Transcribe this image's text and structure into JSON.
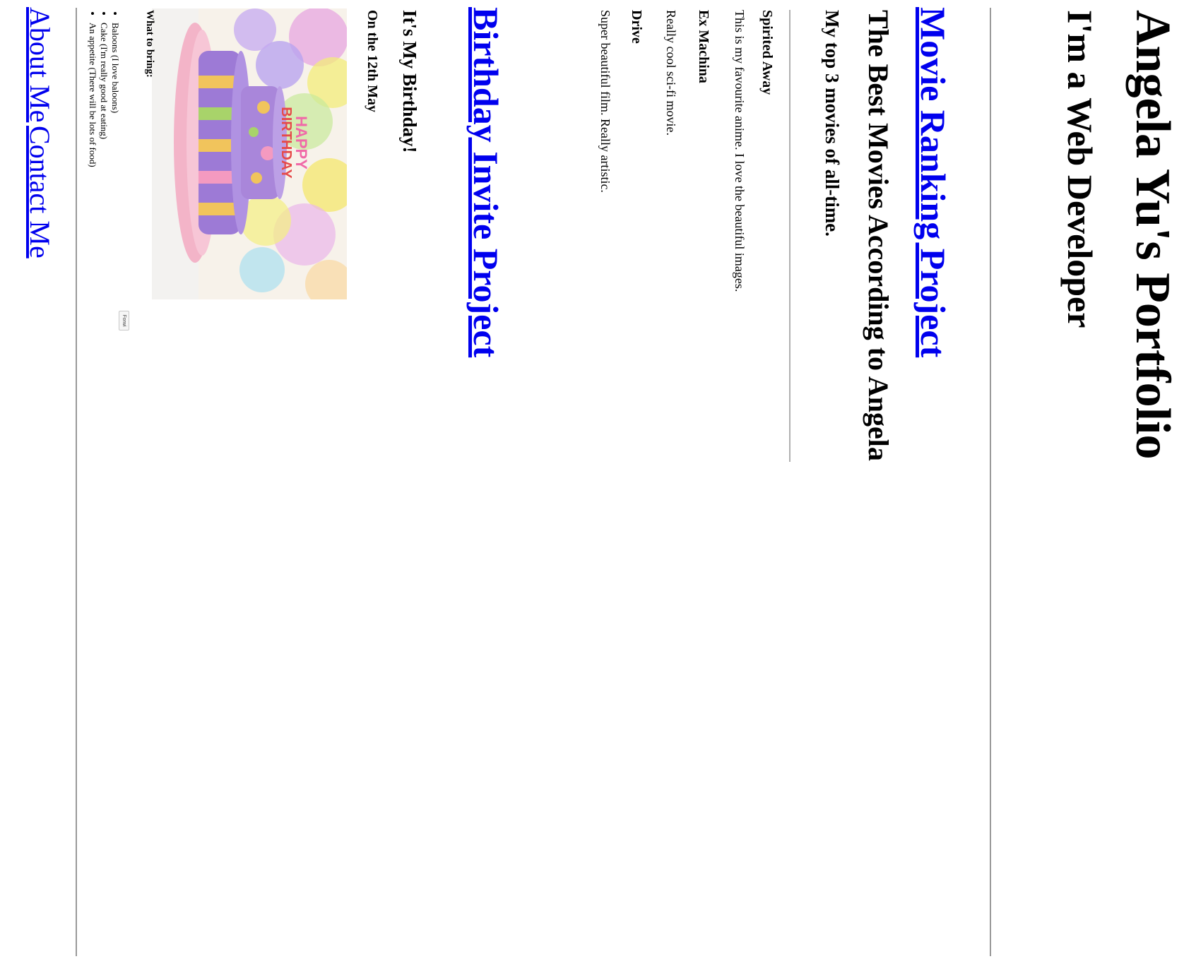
{
  "header": {
    "name": "Angela Yu's Portfolio",
    "subtitle": "I'm a Web Developer"
  },
  "projects": {
    "movie_link": "Movie Ranking Project",
    "birthday_link": "Birthday Invite Project"
  },
  "movies": {
    "title": "The Best Movies According to Angela",
    "subtitle": "My top 3 movies of all-time.",
    "items": [
      {
        "name": "Spirited Away",
        "description": "This is my favourite anime. I love the beautiful images."
      },
      {
        "name": "Ex Machina",
        "description": "Really cool sci-fi movie."
      },
      {
        "name": "Drive",
        "description": "Super beautiful film. Really artistic."
      }
    ]
  },
  "birthday": {
    "title": "It's My Birthday!",
    "date": "On the 12th May",
    "cake_text_line1": "HAPPY",
    "cake_text_line2": "BIRTHDAY",
    "bring_title": "What to bring:",
    "bring_items": [
      "Baloons (I love baloons)",
      "Cake (I'm really good at eating)",
      "An appetite (There will be lots of food)"
    ],
    "forward_button": "Forwi"
  },
  "footer": {
    "about_link": "About Me",
    "contact_link": "Contact Me"
  },
  "colors": {
    "link": "#0000ee",
    "rule": "#9a9a9a"
  }
}
